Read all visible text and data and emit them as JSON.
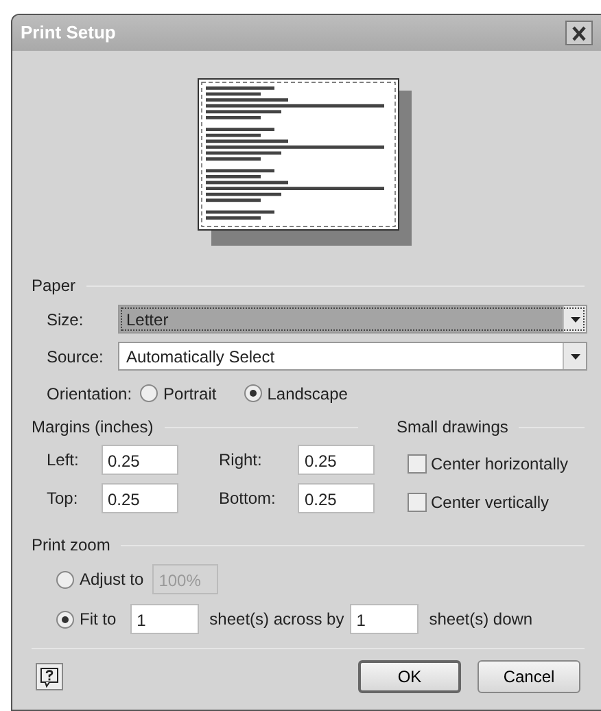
{
  "window": {
    "title": "Print Setup"
  },
  "paper": {
    "heading": "Paper",
    "size": {
      "label": "Size:",
      "value": "Letter",
      "focused": true
    },
    "source": {
      "label": "Source:",
      "value": "Automatically Select",
      "focused": false
    },
    "orientation": {
      "label": "Orientation:",
      "options": [
        {
          "label": "Portrait",
          "selected": false
        },
        {
          "label": "Landscape",
          "selected": true
        }
      ]
    }
  },
  "margins": {
    "heading": "Margins (inches)",
    "fields": [
      {
        "label": "Left:",
        "value": "0.25"
      },
      {
        "label": "Right:",
        "value": "0.25"
      },
      {
        "label": "Top:",
        "value": "0.25"
      },
      {
        "label": "Bottom:",
        "value": "0.25"
      }
    ]
  },
  "small_drawings": {
    "heading": "Small drawings",
    "options": [
      {
        "label": "Center horizontally",
        "checked": false
      },
      {
        "label": "Center vertically",
        "checked": false
      }
    ]
  },
  "print_zoom": {
    "heading": "Print zoom",
    "adjust": {
      "label": "Adjust to",
      "value": "100%",
      "selected": false,
      "disabled": true
    },
    "fit": {
      "label": "Fit to",
      "across_value": "1",
      "across_label": "sheet(s) across by",
      "down_value": "1",
      "down_label": "sheet(s) down",
      "selected": true
    }
  },
  "buttons": [
    {
      "label": "OK",
      "default": true
    },
    {
      "label": "Cancel",
      "default": false
    }
  ]
}
